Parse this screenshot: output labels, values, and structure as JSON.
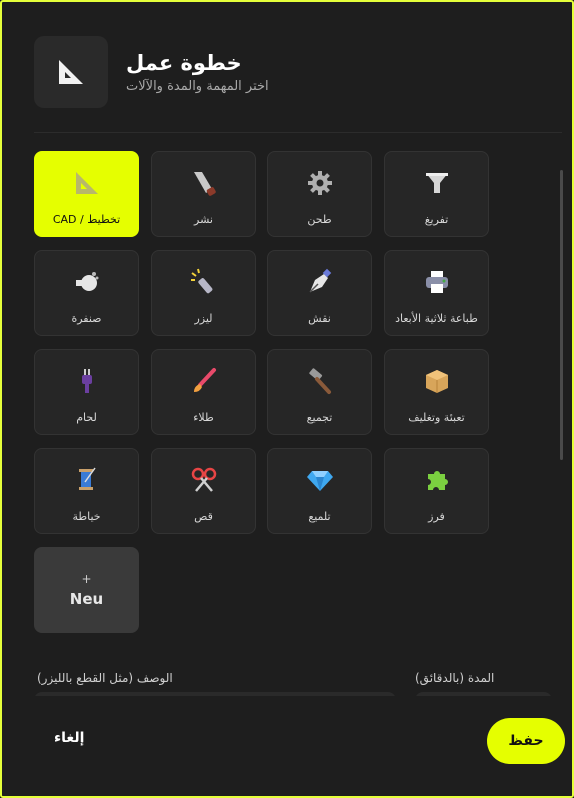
{
  "header": {
    "title": "خطوة عمل",
    "subtitle": "اختر المهمة والمدة والآلات",
    "icon": "set-square-icon"
  },
  "tasks": [
    {
      "label": "CAD / تخطيط",
      "icon": "set-square-icon",
      "active": true
    },
    {
      "label": "نشر",
      "icon": "saw-icon"
    },
    {
      "label": "طحن",
      "icon": "gear-icon"
    },
    {
      "label": "تفريغ",
      "icon": "funnel-icon"
    },
    {
      "label": "صنفرة",
      "icon": "sander-icon"
    },
    {
      "label": "ليزر",
      "icon": "laser-icon"
    },
    {
      "label": "نقش",
      "icon": "pen-nib-icon"
    },
    {
      "label": "طباعة ثلاثية الأبعاد",
      "icon": "printer-icon"
    },
    {
      "label": "لحام",
      "icon": "soldering-iron-icon"
    },
    {
      "label": "طلاء",
      "icon": "paintbrush-icon"
    },
    {
      "label": "تجميع",
      "icon": "hammer-icon"
    },
    {
      "label": "تعبئة وتغليف",
      "icon": "package-icon"
    },
    {
      "label": "خياطة",
      "icon": "thread-spool-icon"
    },
    {
      "label": "قص",
      "icon": "scissors-icon"
    },
    {
      "label": "تلميع",
      "icon": "gem-icon"
    },
    {
      "label": "فرز",
      "icon": "puzzle-icon"
    }
  ],
  "new_tile": {
    "plus": "+",
    "label": "Neu"
  },
  "form": {
    "description_label": "الوصف (مثل القطع بالليزر)",
    "duration_label": "المدة (بالدقائق)"
  },
  "footer": {
    "cancel_label": "إلغاء",
    "save_label": "حفظ"
  },
  "colors": {
    "accent": "#e5ff00",
    "background": "#1e1e1e",
    "tile": "#262626"
  }
}
